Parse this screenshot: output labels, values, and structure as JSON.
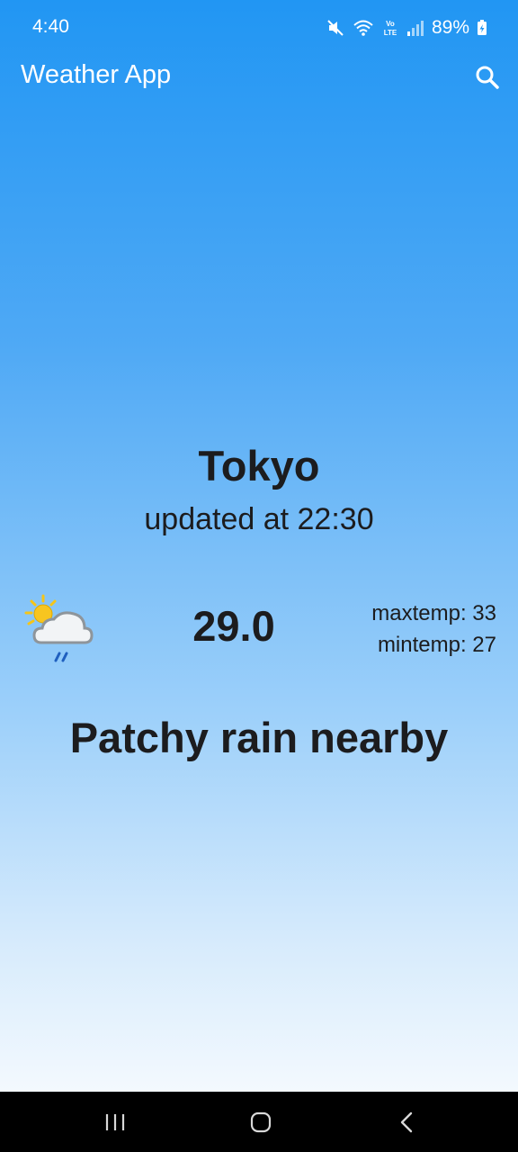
{
  "status_bar": {
    "time": "4:40",
    "battery": "89%",
    "icons": [
      "mute-icon",
      "wifi-icon",
      "volte-icon",
      "signal-icon",
      "battery-charging-icon"
    ]
  },
  "app_bar": {
    "title": "Weather App",
    "search_icon": "search-icon"
  },
  "weather": {
    "city": "Tokyo",
    "updated": "updated at 22:30",
    "temperature": "29.0",
    "max_temp": "maxtemp: 33",
    "min_temp": "mintemp: 27",
    "condition": "Patchy rain nearby",
    "condition_icon": "patchy-rain-icon"
  },
  "nav_bar": {
    "buttons": [
      "recent-apps",
      "home",
      "back"
    ]
  },
  "colors": {
    "app_bar": "#2196f3",
    "text": "#1c1c1e",
    "gradient_end": "#ffffff"
  }
}
